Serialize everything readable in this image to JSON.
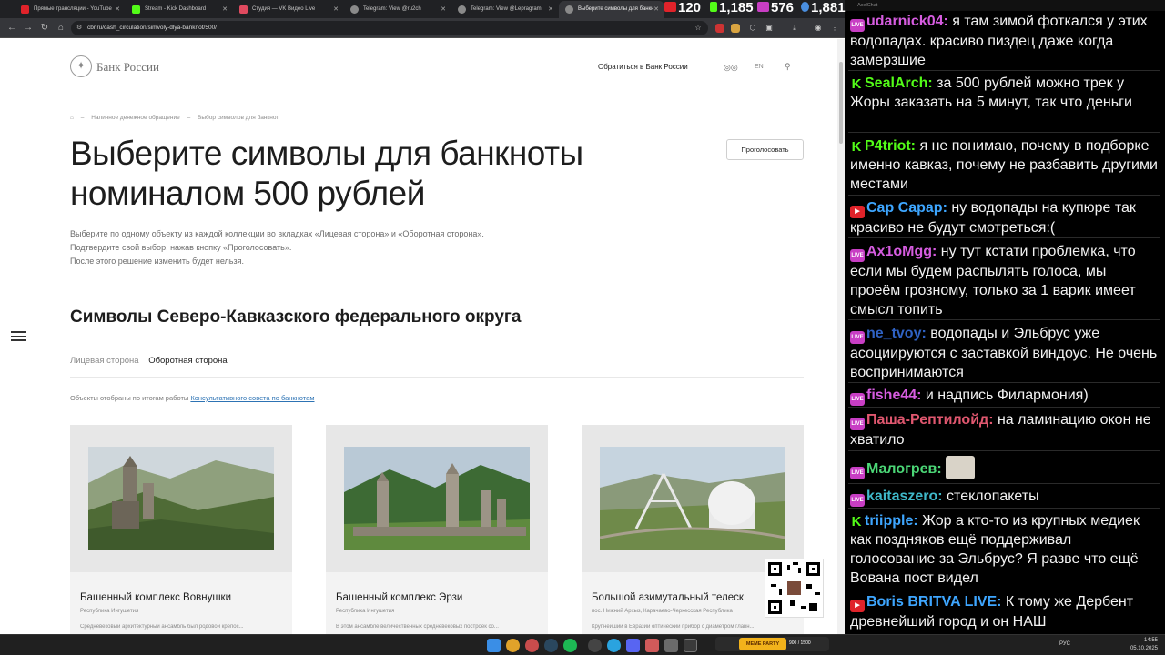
{
  "browser": {
    "tabs": [
      {
        "label": "Прямые трансляции - YouTube",
        "icon_color": "#e0232a"
      },
      {
        "label": "Stream - Kick Dashboard",
        "icon_color": "#53fc18"
      },
      {
        "label": "Студия — VK Видео Live",
        "icon_color": "#e04a5f"
      },
      {
        "label": "Telegram: View @ru2ch",
        "icon_color": "#8a8a8a"
      },
      {
        "label": "Telegram: View @Lepragram",
        "icon_color": "#8a8a8a"
      },
      {
        "label": "Выберите символы для банкн",
        "icon_color": "#8a8a8a"
      }
    ],
    "url": "cbr.ru/cash_circulation/simvoly-dlya-banknot/500/"
  },
  "stats": {
    "youtube": "120",
    "kick": "1,185",
    "vk": "576",
    "total": "1,881"
  },
  "site": {
    "logo_text": "Банк России",
    "appeal_link": "Обратиться в Банк России",
    "lang": "EN",
    "breadcrumb": [
      "Наличное денежное обращение",
      "Выбор символов для банкнот"
    ],
    "title": "Выберите символы для банкноты номиналом 500 рублей",
    "vote_button": "Проголосовать",
    "intro": [
      "Выберите по одному объекту из каждой коллекции во вкладках «Лицевая сторона» и «Оборотная сторона».",
      "Подтвердите свой выбор, нажав кнопку «Проголосовать».",
      "После этого решение изменить будет нельзя."
    ],
    "section_title": "Символы Северо-Кавказского федерального округа",
    "tabs": {
      "front": "Лицевая сторона",
      "back": "Оборотная сторона"
    },
    "selection_note": "Объекты отобраны по итогам работы ",
    "selection_link": "Консультативного совета по банкнотам",
    "cards": [
      {
        "title": "Башенный комплекс Вовнушки",
        "region": "Республика Ингушетия",
        "desc": "Средневековый архитектурный ансамбль был родовой крепос..."
      },
      {
        "title": "Башенный комплекс Эрзи",
        "region": "Республика Ингушетия",
        "desc": "В этом ансамбле величественных средневековых построек со..."
      },
      {
        "title": "Большой азимутальный телеск",
        "region": "пос. Нижний Архыз, Карачаево-Черкесская Республика",
        "desc": "Крупнейший в Евразии оптический прибор с диаметром главн..."
      }
    ]
  },
  "chat": {
    "header": "AxelChat",
    "messages": [
      {
        "platform": "vk",
        "nick": "udarnick04:",
        "color": "#d65ce0",
        "text": "я там зимой фоткался у этих водопадах. красиво пиздец даже когда замерзшие"
      },
      {
        "platform": "kick",
        "nick": "SealArch:",
        "color": "#53fc18",
        "text": "за 500 рублей можно трек у Жоры заказать на 5 минут, так что деньги"
      },
      {
        "platform": "kick",
        "nick": "P4triot:",
        "color": "#53fc18",
        "text": "я не понимаю, почему в подборке именно кавказ, почему не разбавить другими местами"
      },
      {
        "platform": "yt",
        "nick": "Cap Capap:",
        "color": "#3ea6ff",
        "text": "ну водопады на купюре так красиво не будут смотреться:("
      },
      {
        "platform": "vk",
        "nick": "Ax1oMgg:",
        "color": "#d65ce0",
        "text": "ну тут кстати проблемка, что если мы будем распылять голоса, мы проеём грозному, только за 1 варик имеет смысл топить"
      },
      {
        "platform": "vk",
        "nick": "ne_tvoy:",
        "color": "#2f62c4",
        "text": "водопады и Эльбрус уже асоциируются с заставкой виндоус. Не очень воспринимаются"
      },
      {
        "platform": "vk",
        "nick": "fishe44:",
        "color": "#d65ce0",
        "text": "и надпись Филармония)"
      },
      {
        "platform": "vk",
        "nick": "Паша-Рептилойд:",
        "color": "#e0576f",
        "text": "на ламинацию окон не хватило"
      },
      {
        "platform": "vk",
        "nick": "Малогрев:",
        "color": "#4bd676",
        "text": ""
      },
      {
        "platform": "vk",
        "nick": "kaitaszero:",
        "color": "#3fb8c9",
        "text": "стеклопакеты"
      },
      {
        "platform": "kick",
        "nick": "triipple:",
        "color": "#3ea6ff",
        "text": "Жор а кто-то из крупных медиек как поздняков ещё поддерживал голосование за Эльбрус? Я разве что ещё Вована пост видел"
      },
      {
        "platform": "yt",
        "nick": "Boris BRITVA LIVE:",
        "color": "#3ea6ff",
        "text": "К тому же Дербент древнейший город и он НАШ"
      }
    ]
  },
  "taskbar": {
    "lang": "РУС",
    "time": "14:55",
    "date": "05.10.2025",
    "music_label": "MEME PARTY",
    "music_progress": "900 / 1500"
  }
}
